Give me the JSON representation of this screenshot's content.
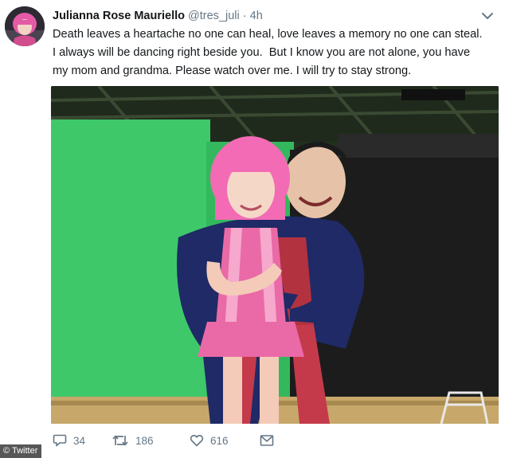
{
  "tweet": {
    "display_name": "Julianna Rose Mauriello",
    "handle": "@tres_juli",
    "separator": "·",
    "time": "4h",
    "text": "Death leaves a heartache no one can heal, love leaves a memory no one can steal.\nI always will be dancing right beside you.  But I know you are not alone, you have\nmy mom and grandma. Please watch over me. I will try to stay strong."
  },
  "actions": {
    "reply_count": "34",
    "retweet_count": "186",
    "like_count": "616"
  },
  "icons": {
    "reply": "speech-bubble-icon",
    "retweet": "retweet-arrows-icon",
    "like": "heart-icon",
    "message": "envelope-icon",
    "more": "chevron-down-icon"
  },
  "colors": {
    "text": "#14171a",
    "muted": "#657786",
    "green_screen": "#3ec86a",
    "pink_hair": "#f26bb4"
  },
  "credit": "© Twitter"
}
